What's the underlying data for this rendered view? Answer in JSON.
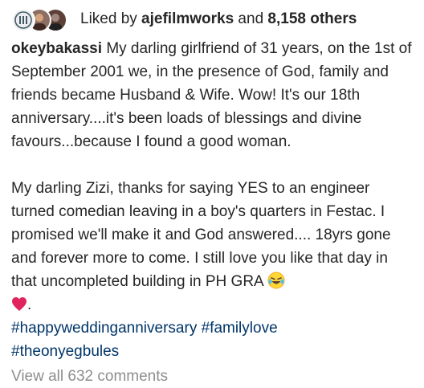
{
  "likes": {
    "liked_by_prefix": "Liked by ",
    "liked_by_user": "ajefilmworks",
    "joiner": " and ",
    "others_count": "8,158 others",
    "avatars": [
      "brand-logo-avatar",
      "user-avatar",
      "user-avatar"
    ]
  },
  "caption": {
    "username": "okeybakassi",
    "paragraph1": "My darling girlfriend of 31 years, on the 1st of September 2001 we, in the presence of God, family and friends became Husband & Wife. Wow! It's our 18th anniversary....it's been loads of blessings and divine favours...because I found a good woman.",
    "paragraph2": "My darling Zizi, thanks for saying YES to an engineer turned comedian leaving in a boy's quarters in Festac. I promised we'll make it and God answered.... 18yrs gone and forever more to come. I still love you like that day in that uncompleted building in PH GRA",
    "trailing_dot": ".",
    "hashtags": [
      "#happyweddinganniversary #familylove",
      "#theonyegbules"
    ],
    "emojis": [
      "laughing-face-emoji",
      "red-heart-emoji"
    ]
  },
  "comments": {
    "view_all": "View all 632 comments"
  },
  "colors": {
    "text": "#262626",
    "link": "#003569",
    "muted": "#8e8e8e",
    "heart": "#e0245e",
    "emoji_face": "#fdd835"
  }
}
